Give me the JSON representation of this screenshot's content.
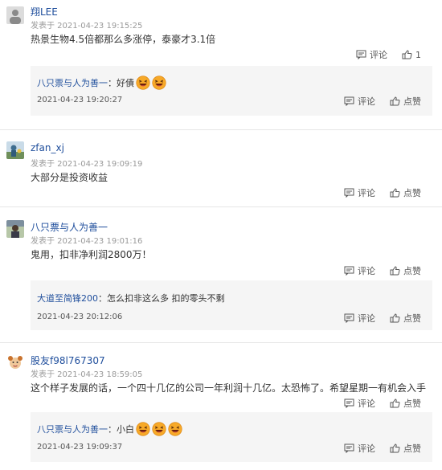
{
  "comments": [
    {
      "username": "翔LEE",
      "time": "发表于 2021-04-23 19:15:25",
      "text": "热景生物4.5倍都那么多涨停，泰豪才3.1倍",
      "actions": {
        "comment": "评论",
        "like": "1"
      },
      "reply": {
        "user": "八只票与人为善一",
        "colon": "：",
        "text": "好債",
        "time": "2021-04-23 19:20:27",
        "actions": {
          "comment": "评论",
          "like": "点赞"
        }
      }
    },
    {
      "username": "zfan_xj",
      "time": "发表于 2021-04-23 19:09:19",
      "text": "大部分是投资收益",
      "actions": {
        "comment": "评论",
        "like": "点赞"
      }
    },
    {
      "username": "八只票与人为善一",
      "time": "发表于 2021-04-23 19:01:16",
      "text": "鬼用，扣非净利润2800万！",
      "actions": {
        "comment": "评论",
        "like": "点赞"
      },
      "reply": {
        "user": "大道至简锋200",
        "colon": "：",
        "text": "怎么扣非这么多 扣的零头不剩",
        "time": "2021-04-23 20:12:06",
        "actions": {
          "comment": "评论",
          "like": "点赞"
        }
      }
    },
    {
      "username": "股友f98l767307",
      "time": "发表于 2021-04-23 18:59:05",
      "text": "这个样子发展的话，一个四十几亿的公司一年利润十几亿。太恐怖了。希望星期一有机会入手",
      "actions": {
        "comment": "评论",
        "like": "点赞"
      },
      "reply": {
        "user": "八只票与人为善一",
        "colon": "：",
        "text": "小白",
        "time": "2021-04-23 19:09:37",
        "actions": {
          "comment": "评论",
          "like": "点赞"
        }
      }
    }
  ],
  "icons": {
    "comment": "comment-icon",
    "like": "thumbs-up-icon",
    "emoji": "laughing-emoji-icon"
  },
  "colors": {
    "username": "#1f4e9c",
    "reply_bg": "#f5f5f5",
    "meta": "#999999"
  }
}
